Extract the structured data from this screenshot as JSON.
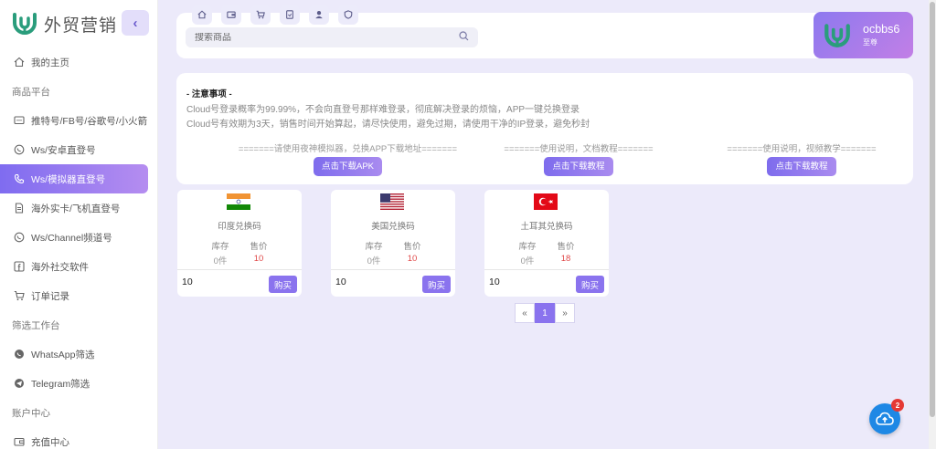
{
  "app": {
    "brand": "外贸营销",
    "collapse_icon": "chevron-left-icon"
  },
  "sidebar": {
    "items": [
      {
        "type": "item",
        "label": "我的主页",
        "icon": "home-icon"
      },
      {
        "type": "group",
        "label": "商品平台"
      },
      {
        "type": "item",
        "label": "推特号/FB号/谷歌号/小火箭",
        "icon": "chat-dots-icon"
      },
      {
        "type": "item",
        "label": "Ws/安卓直登号",
        "icon": "whatsapp-icon"
      },
      {
        "type": "item",
        "label": "Ws/模拟器直登号",
        "icon": "phone-icon",
        "active": true
      },
      {
        "type": "item",
        "label": "海外实卡/飞机直登号",
        "icon": "document-icon"
      },
      {
        "type": "item",
        "label": "Ws/Channel频道号",
        "icon": "whatsapp-icon"
      },
      {
        "type": "item",
        "label": "海外社交软件",
        "icon": "facebook-icon"
      },
      {
        "type": "item",
        "label": "订单记录",
        "icon": "cart-icon"
      },
      {
        "type": "group",
        "label": "筛选工作台"
      },
      {
        "type": "item",
        "label": "WhatsApp筛选",
        "icon": "whatsapp-icon"
      },
      {
        "type": "item",
        "label": "Telegram筛选",
        "icon": "telegram-icon"
      },
      {
        "type": "group",
        "label": "账户中心"
      },
      {
        "type": "item",
        "label": "充值中心",
        "icon": "wallet-icon"
      }
    ]
  },
  "toolbar": {
    "icons": [
      "home-icon",
      "wallet-icon",
      "cart-icon",
      "document-icon",
      "user-icon",
      "shield-icon"
    ],
    "search_placeholder": "搜索商品"
  },
  "user": {
    "name": "ocbbs6",
    "level": "至尊"
  },
  "notice": {
    "title": "- 注意事项 -",
    "lines": [
      "Cloud号登录概率为99.99%，不会向直登号那样难登录，彻底解决登录的烦恼，APP一键兑换登录",
      "Cloud号有效期为3天，销售时间开始算起，请尽快使用，避免过期，请使用干净的IP登录，避免秒封"
    ],
    "downloads": [
      {
        "caption": "=======请使用夜神模拟器，兑换APP下载地址=======",
        "button": "点击下载APK"
      },
      {
        "caption": "=======使用说明，文档教程=======",
        "button": "点击下载教程"
      },
      {
        "caption": "=======使用说明，视频教学=======",
        "button": "点击下载教程"
      }
    ]
  },
  "products": {
    "stock_label": "库存",
    "price_label": "售价",
    "buy_label": "购买",
    "items": [
      {
        "name": "印度兑换码",
        "flag": "india-flag-icon",
        "stock": "0件",
        "price": "10",
        "quantity": "10"
      },
      {
        "name": "美国兑换码",
        "flag": "usa-flag-icon",
        "stock": "0件",
        "price": "10",
        "quantity": "10"
      },
      {
        "name": "土耳其兑换码",
        "flag": "turkey-flag-icon",
        "stock": "0件",
        "price": "18",
        "quantity": "10"
      }
    ]
  },
  "pagination": {
    "prev": "«",
    "current": "1",
    "next": "»"
  },
  "upload": {
    "icon": "cloud-upload-icon",
    "badge": "2"
  },
  "colors": {
    "accent": "#8a73ee",
    "background": "#eceafa",
    "price": "#e04848",
    "logo_green": "#2a9d7c",
    "upload_blue": "#1e88e5",
    "badge_red": "#e53935"
  }
}
